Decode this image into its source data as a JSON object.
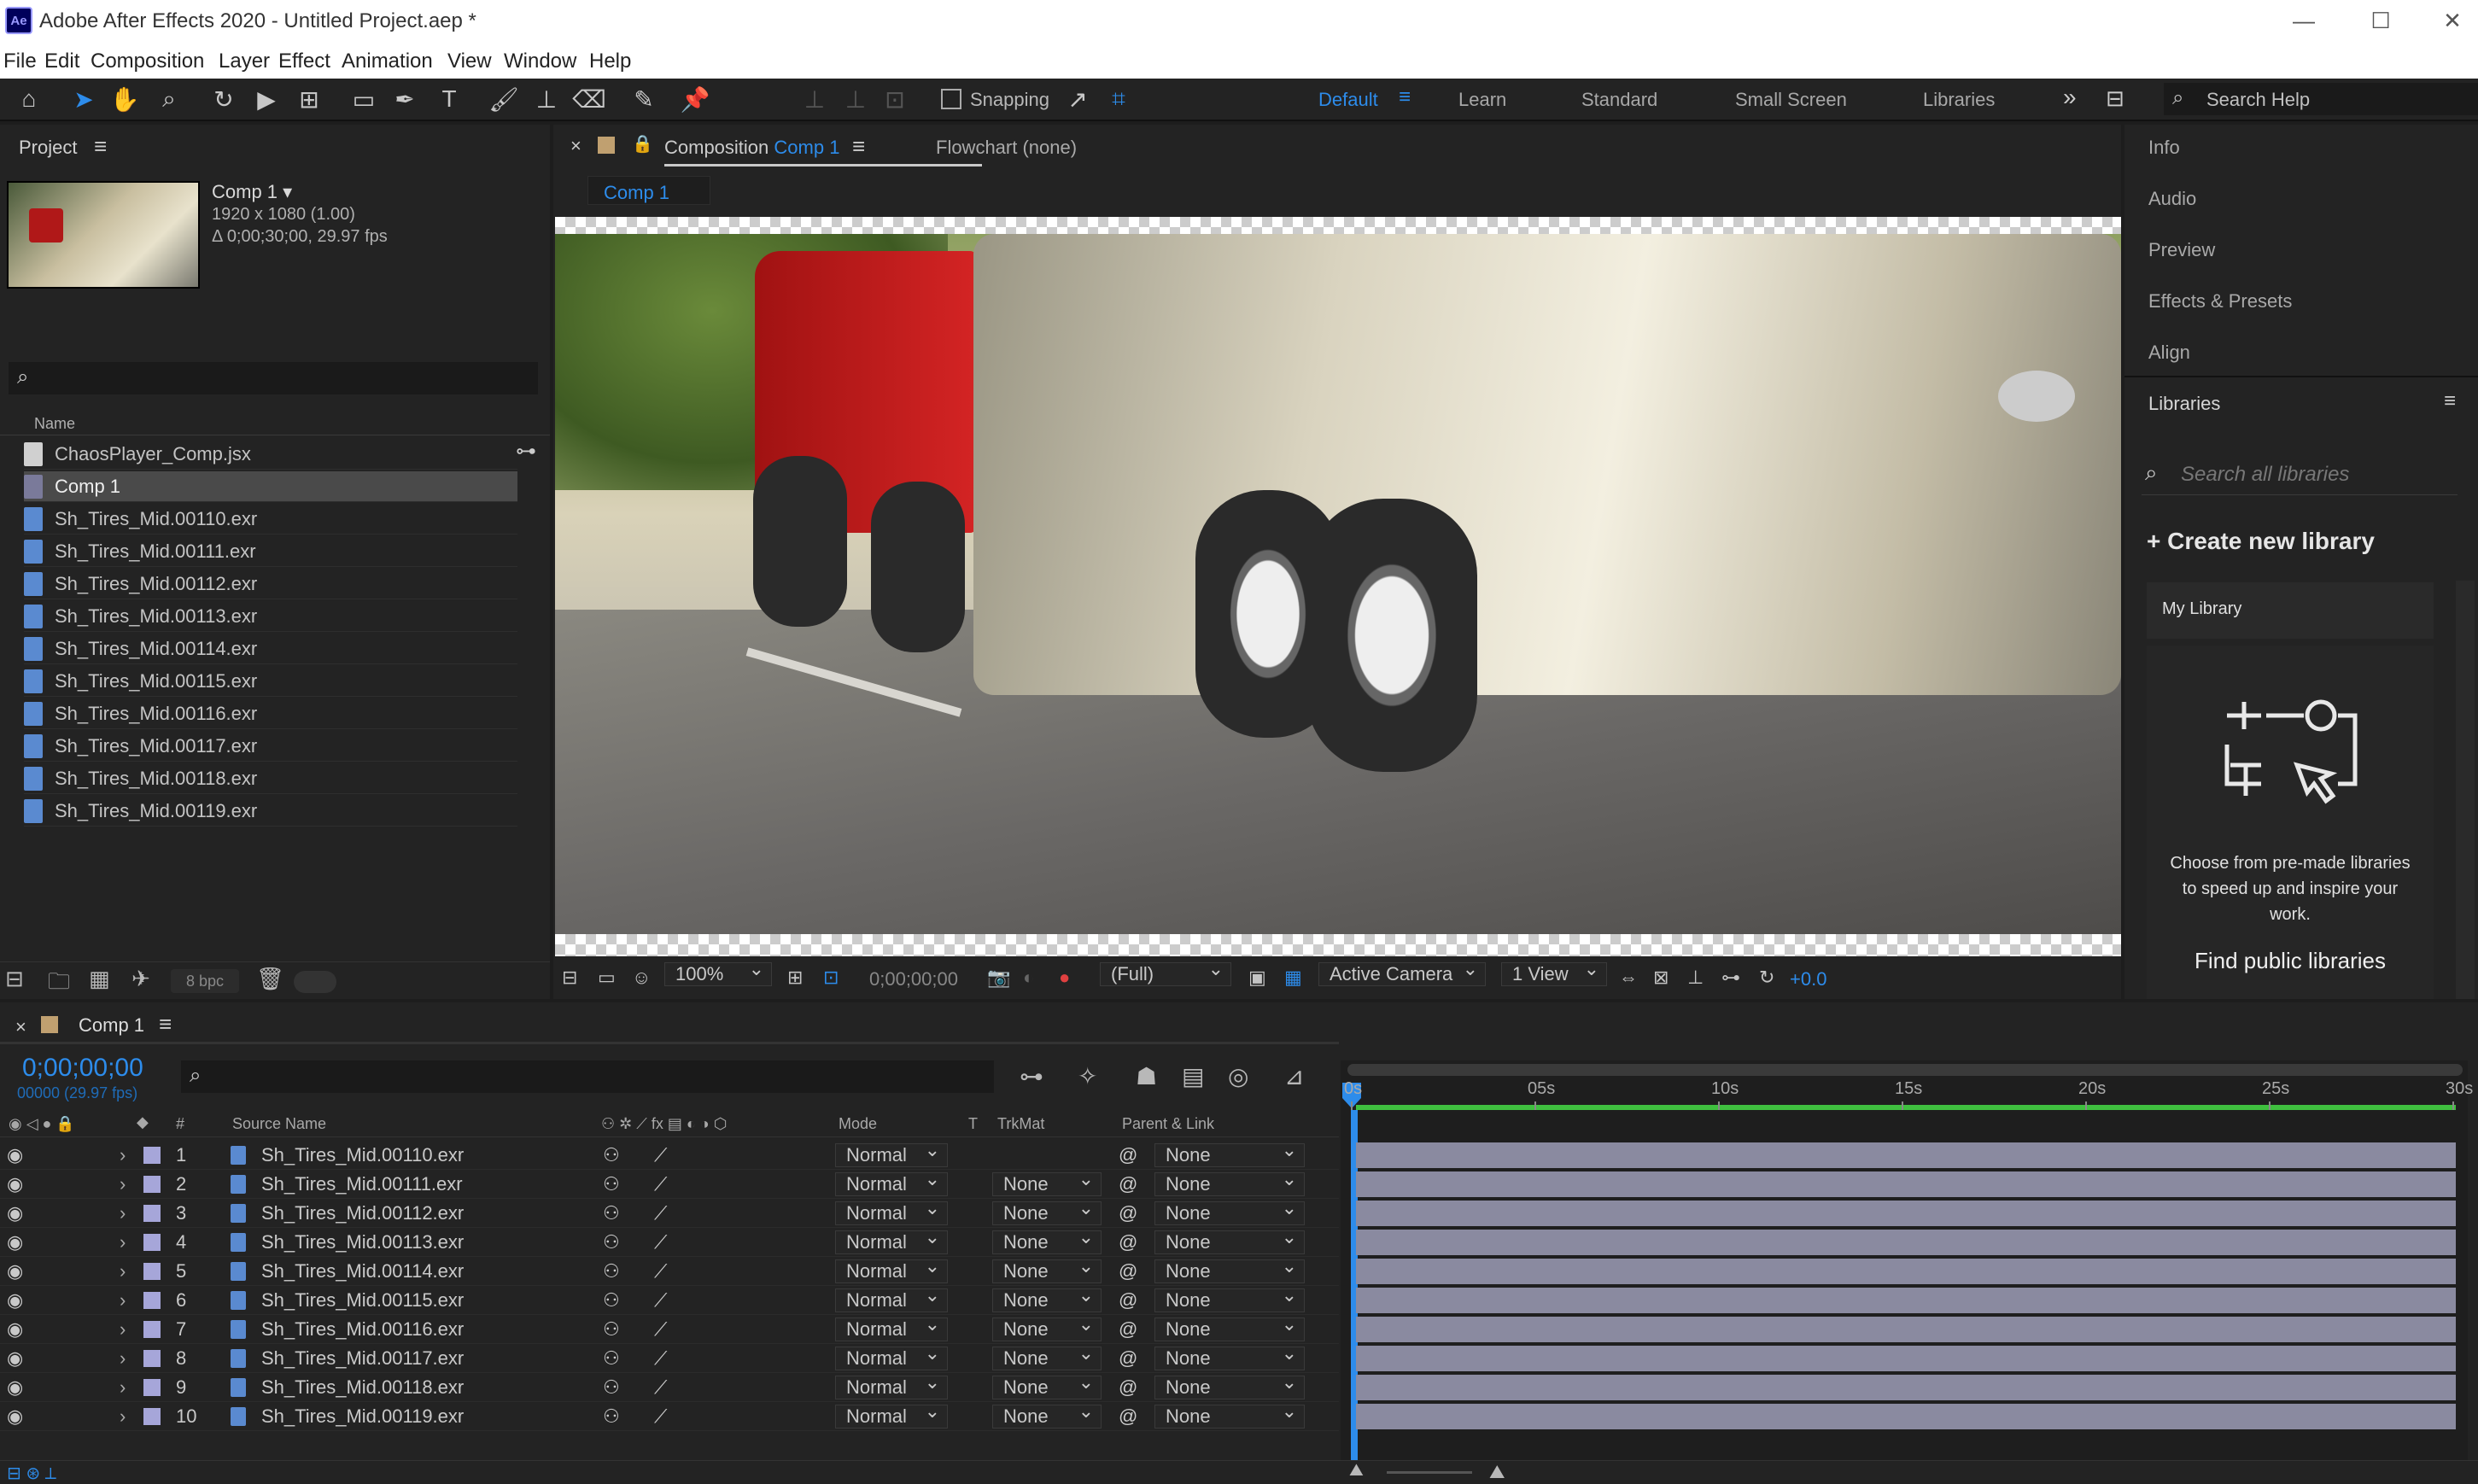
{
  "app": {
    "title": "Adobe After Effects 2020 - Untitled Project.aep *",
    "icon": "Ae"
  },
  "menu": [
    "File",
    "Edit",
    "Composition",
    "Layer",
    "Effect",
    "Animation",
    "View",
    "Window",
    "Help"
  ],
  "toolbar": {
    "snapping_label": "Snapping",
    "workspaces": [
      "Default",
      "Learn",
      "Standard",
      "Small Screen",
      "Libraries"
    ],
    "active_workspace": "Default",
    "search_placeholder": "Search Help"
  },
  "project": {
    "title": "Project",
    "comp_name": "Comp 1",
    "comp_res": "1920 x 1080 (1.00)",
    "comp_dur": "Δ 0;00;30;00, 29.97 fps",
    "col_name": "Name",
    "bpc": "8 bpc",
    "items": [
      {
        "name": "ChaosPlayer_Comp.jsx",
        "type": "script"
      },
      {
        "name": "Comp 1",
        "type": "comp"
      },
      {
        "name": "Sh_Tires_Mid.00110.exr",
        "type": "exr"
      },
      {
        "name": "Sh_Tires_Mid.00111.exr",
        "type": "exr"
      },
      {
        "name": "Sh_Tires_Mid.00112.exr",
        "type": "exr"
      },
      {
        "name": "Sh_Tires_Mid.00113.exr",
        "type": "exr"
      },
      {
        "name": "Sh_Tires_Mid.00114.exr",
        "type": "exr"
      },
      {
        "name": "Sh_Tires_Mid.00115.exr",
        "type": "exr"
      },
      {
        "name": "Sh_Tires_Mid.00116.exr",
        "type": "exr"
      },
      {
        "name": "Sh_Tires_Mid.00117.exr",
        "type": "exr"
      },
      {
        "name": "Sh_Tires_Mid.00118.exr",
        "type": "exr"
      },
      {
        "name": "Sh_Tires_Mid.00119.exr",
        "type": "exr"
      }
    ]
  },
  "viewer": {
    "tab_prefix": "Composition",
    "tab_comp": "Comp 1",
    "flowchart": "Flowchart",
    "flowchart_value": "(none)",
    "breadcrumb": "Comp 1",
    "zoom": "100%",
    "timecode": "0;00;00;00",
    "resolution": "(Full)",
    "camera": "Active Camera",
    "views": "1 View",
    "exposure": "+0.0"
  },
  "right_panel": {
    "items": [
      "Info",
      "Audio",
      "Preview",
      "Effects & Presets",
      "Align"
    ],
    "libraries_title": "Libraries",
    "lib_search_placeholder": "Search all libraries",
    "create_label": "Create new library",
    "my_library": "My Library",
    "promo_text": "Choose from pre-made libraries to speed up and inspire your work.",
    "find_label": "Find public libraries"
  },
  "timeline": {
    "tab": "Comp 1",
    "timecode": "0;00;00;00",
    "frame_info": "00000 (29.97 fps)",
    "headers": {
      "num": "#",
      "source": "Source Name",
      "mode": "Mode",
      "t": "T",
      "trkmat": "TrkMat",
      "parent": "Parent & Link"
    },
    "ruler": [
      "0s",
      "05s",
      "10s",
      "15s",
      "20s",
      "25s",
      "30s"
    ],
    "layers": [
      {
        "num": "1",
        "name": "Sh_Tires_Mid.00110.exr",
        "mode": "Normal",
        "trkmat": "",
        "parent": "None"
      },
      {
        "num": "2",
        "name": "Sh_Tires_Mid.00111.exr",
        "mode": "Normal",
        "trkmat": "None",
        "parent": "None"
      },
      {
        "num": "3",
        "name": "Sh_Tires_Mid.00112.exr",
        "mode": "Normal",
        "trkmat": "None",
        "parent": "None"
      },
      {
        "num": "4",
        "name": "Sh_Tires_Mid.00113.exr",
        "mode": "Normal",
        "trkmat": "None",
        "parent": "None"
      },
      {
        "num": "5",
        "name": "Sh_Tires_Mid.00114.exr",
        "mode": "Normal",
        "trkmat": "None",
        "parent": "None"
      },
      {
        "num": "6",
        "name": "Sh_Tires_Mid.00115.exr",
        "mode": "Normal",
        "trkmat": "None",
        "parent": "None"
      },
      {
        "num": "7",
        "name": "Sh_Tires_Mid.00116.exr",
        "mode": "Normal",
        "trkmat": "None",
        "parent": "None"
      },
      {
        "num": "8",
        "name": "Sh_Tires_Mid.00117.exr",
        "mode": "Normal",
        "trkmat": "None",
        "parent": "None"
      },
      {
        "num": "9",
        "name": "Sh_Tires_Mid.00118.exr",
        "mode": "Normal",
        "trkmat": "None",
        "parent": "None"
      },
      {
        "num": "10",
        "name": "Sh_Tires_Mid.00119.exr",
        "mode": "Normal",
        "trkmat": "None",
        "parent": "None"
      }
    ]
  },
  "colors": {
    "accent": "#2d8ceb",
    "layer_label": "#a6a6d9",
    "bar": "#8a8aa0",
    "work_area": "#3fbf3f"
  }
}
